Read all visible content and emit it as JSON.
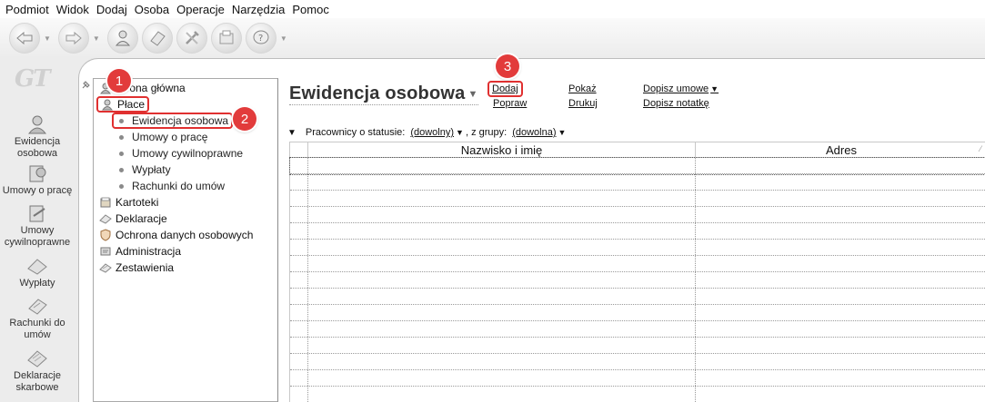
{
  "menu": [
    "Podmiot",
    "Widok",
    "Dodaj",
    "Osoba",
    "Operacje",
    "Narzędzia",
    "Pomoc"
  ],
  "toolbar": {
    "buttons": [
      "back-icon",
      "forward-icon",
      "person-icon",
      "eraser-icon",
      "tools-icon",
      "scanner-icon",
      "help-icon"
    ]
  },
  "logo": "GT",
  "leftnav": [
    {
      "label": "Ewidencja osobowa",
      "icon": "person-card-icon"
    },
    {
      "label": "Umowy o pracę",
      "icon": "contract-icon"
    },
    {
      "label": "Umowy cywilnoprawne",
      "icon": "civil-contract-icon"
    },
    {
      "label": "Wypłaty",
      "icon": "payout-icon"
    },
    {
      "label": "Rachunki do umów",
      "icon": "bill-icon"
    },
    {
      "label": "Deklaracje skarbowe",
      "icon": "tax-icon"
    }
  ],
  "tree": {
    "items": [
      {
        "label": "Strona główna",
        "icon": "home-icon"
      },
      {
        "label": "Płace",
        "icon": "payroll-icon"
      },
      {
        "label": "Kartoteki",
        "icon": "records-icon"
      },
      {
        "label": "Deklaracje",
        "icon": "declarations-icon"
      },
      {
        "label": "Ochrona danych osobowych",
        "icon": "shield-icon"
      },
      {
        "label": "Administracja",
        "icon": "admin-icon"
      },
      {
        "label": "Zestawienia",
        "icon": "reports-icon"
      }
    ],
    "subitems": [
      "Ewidencja osobowa",
      "Umowy o pracę",
      "Umowy cywilnoprawne",
      "Wypłaty",
      "Rachunki do umów"
    ]
  },
  "badges": [
    "1",
    "2",
    "3"
  ],
  "main": {
    "title": "Ewidencja osobowa",
    "actions": {
      "dodaj": "Dodaj",
      "popraw": "Popraw",
      "pokaz": "Pokaż",
      "drukuj": "Drukuj",
      "dopisz_umowe": "Dopisz umowe",
      "dopisz_notatke": "Dopisz notatkę"
    },
    "filter": {
      "label": "Pracownicy o statusie:",
      "status_value": "(dowolny)",
      "group_label": ", z grupy:",
      "group_value": "(dowolna)"
    },
    "columns": [
      "Nazwisko i imię",
      "Adres"
    ]
  },
  "colors": {
    "highlight": "#e03030",
    "badge": "#e23b3b"
  }
}
